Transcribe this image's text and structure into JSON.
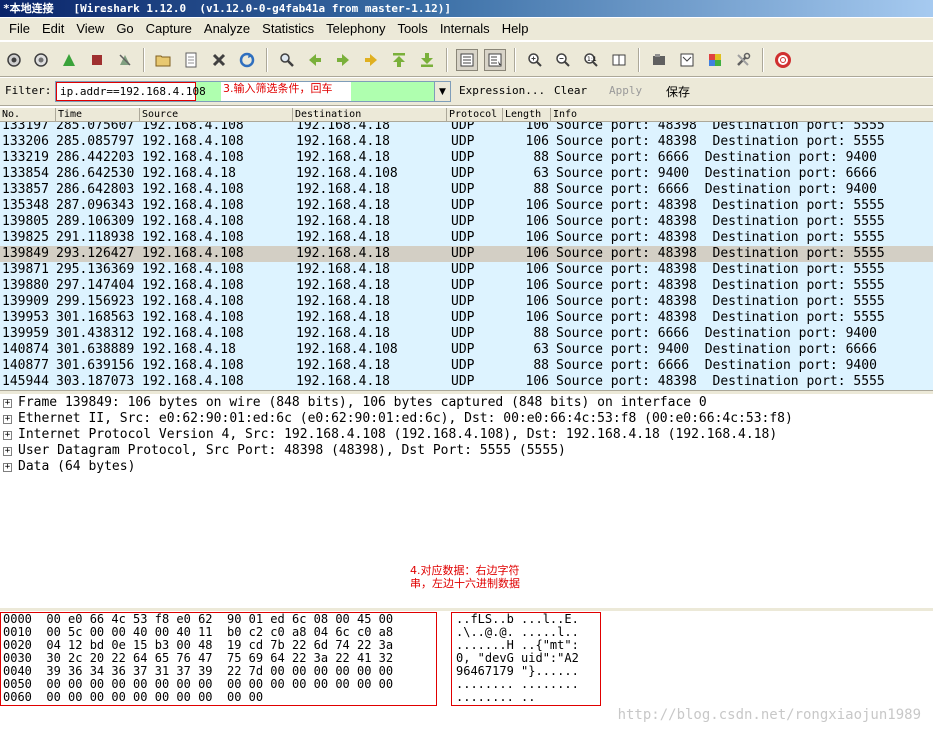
{
  "window": {
    "title": "*本地连接   [Wireshark 1.12.0  (v1.12.0-0-g4fab41a from master-1.12)]"
  },
  "menu": [
    "File",
    "Edit",
    "View",
    "Go",
    "Capture",
    "Analyze",
    "Statistics",
    "Telephony",
    "Tools",
    "Internals",
    "Help"
  ],
  "filter": {
    "label": "Filter:",
    "value": "ip.addr==192.168.4.108",
    "annotation": "3.输入筛选条件，回车",
    "expression_label": "Expression...",
    "clear_label": "Clear",
    "apply_label": "Apply",
    "save_label": "保存"
  },
  "packet_list": {
    "columns": [
      "No.",
      "Time",
      "Source",
      "Destination",
      "Protocol",
      "Length",
      "Info"
    ],
    "partial_row": {
      "no": "133197",
      "time": "285.075607",
      "source": "192.168.4.108",
      "destination": "192.168.4.18",
      "protocol": "UDP",
      "length": "106",
      "info": "Source port: 48398  Destination port: 5555"
    },
    "rows": [
      {
        "no": "133206",
        "time": "285.085797",
        "source": "192.168.4.108",
        "destination": "192.168.4.18",
        "protocol": "UDP",
        "length": "106",
        "info": "Source port: 48398  Destination port: 5555"
      },
      {
        "no": "133219",
        "time": "286.442203",
        "source": "192.168.4.108",
        "destination": "192.168.4.18",
        "protocol": "UDP",
        "length": "88",
        "info": "Source port: 6666  Destination port: 9400"
      },
      {
        "no": "133854",
        "time": "286.642530",
        "source": "192.168.4.18",
        "destination": "192.168.4.108",
        "protocol": "UDP",
        "length": "63",
        "info": "Source port: 9400  Destination port: 6666"
      },
      {
        "no": "133857",
        "time": "286.642803",
        "source": "192.168.4.108",
        "destination": "192.168.4.18",
        "protocol": "UDP",
        "length": "88",
        "info": "Source port: 6666  Destination port: 9400"
      },
      {
        "no": "135348",
        "time": "287.096343",
        "source": "192.168.4.108",
        "destination": "192.168.4.18",
        "protocol": "UDP",
        "length": "106",
        "info": "Source port: 48398  Destination port: 5555"
      },
      {
        "no": "139805",
        "time": "289.106309",
        "source": "192.168.4.108",
        "destination": "192.168.4.18",
        "protocol": "UDP",
        "length": "106",
        "info": "Source port: 48398  Destination port: 5555"
      },
      {
        "no": "139825",
        "time": "291.118938",
        "source": "192.168.4.108",
        "destination": "192.168.4.18",
        "protocol": "UDP",
        "length": "106",
        "info": "Source port: 48398  Destination port: 5555"
      },
      {
        "no": "139849",
        "time": "293.126427",
        "source": "192.168.4.108",
        "destination": "192.168.4.18",
        "protocol": "UDP",
        "length": "106",
        "info": "Source port: 48398  Destination port: 5555",
        "selected": true
      },
      {
        "no": "139871",
        "time": "295.136369",
        "source": "192.168.4.108",
        "destination": "192.168.4.18",
        "protocol": "UDP",
        "length": "106",
        "info": "Source port: 48398  Destination port: 5555"
      },
      {
        "no": "139880",
        "time": "297.147404",
        "source": "192.168.4.108",
        "destination": "192.168.4.18",
        "protocol": "UDP",
        "length": "106",
        "info": "Source port: 48398  Destination port: 5555"
      },
      {
        "no": "139909",
        "time": "299.156923",
        "source": "192.168.4.108",
        "destination": "192.168.4.18",
        "protocol": "UDP",
        "length": "106",
        "info": "Source port: 48398  Destination port: 5555"
      },
      {
        "no": "139953",
        "time": "301.168563",
        "source": "192.168.4.108",
        "destination": "192.168.4.18",
        "protocol": "UDP",
        "length": "106",
        "info": "Source port: 48398  Destination port: 5555"
      },
      {
        "no": "139959",
        "time": "301.438312",
        "source": "192.168.4.108",
        "destination": "192.168.4.18",
        "protocol": "UDP",
        "length": "88",
        "info": "Source port: 6666  Destination port: 9400"
      },
      {
        "no": "140874",
        "time": "301.638889",
        "source": "192.168.4.18",
        "destination": "192.168.4.108",
        "protocol": "UDP",
        "length": "63",
        "info": "Source port: 9400  Destination port: 6666"
      },
      {
        "no": "140877",
        "time": "301.639156",
        "source": "192.168.4.108",
        "destination": "192.168.4.18",
        "protocol": "UDP",
        "length": "88",
        "info": "Source port: 6666  Destination port: 9400"
      },
      {
        "no": "145944",
        "time": "303.187073",
        "source": "192.168.4.108",
        "destination": "192.168.4.18",
        "protocol": "UDP",
        "length": "106",
        "info": "Source port: 48398  Destination port: 5555"
      }
    ]
  },
  "details": [
    "Frame 139849: 106 bytes on wire (848 bits), 106 bytes captured (848 bits) on interface 0",
    "Ethernet II, Src: e0:62:90:01:ed:6c (e0:62:90:01:ed:6c), Dst: 00:e0:66:4c:53:f8 (00:e0:66:4c:53:f8)",
    "Internet Protocol Version 4, Src: 192.168.4.108 (192.168.4.108), Dst: 192.168.4.18 (192.168.4.18)",
    "User Datagram Protocol, Src Port: 48398 (48398), Dst Port: 5555 (5555)",
    "Data (64 bytes)"
  ],
  "annotation_data": "4.对应数据：右边字符串，左边十六进制数据",
  "bytes": {
    "hex": [
      "0000  00 e0 66 4c 53 f8 e0 62  90 01 ed 6c 08 00 45 00",
      "0010  00 5c 00 00 40 00 40 11  b0 c2 c0 a8 04 6c c0 a8",
      "0020  04 12 bd 0e 15 b3 00 48  19 cd 7b 22 6d 74 22 3a",
      "0030  30 2c 20 22 64 65 76 47  75 69 64 22 3a 22 41 32",
      "0040  39 36 34 36 37 31 37 39  22 7d 00 00 00 00 00 00",
      "0050  00 00 00 00 00 00 00 00  00 00 00 00 00 00 00 00",
      "0060  00 00 00 00 00 00 00 00  00 00"
    ],
    "ascii": [
      "..fLS..b ...l..E.",
      ".\\..@.@. .....l..",
      ".......H ..{\"mt\":",
      "0, \"devG uid\":\"A2",
      "96467179 \"}......",
      "........ ........",
      "........ .."
    ]
  },
  "watermark": "http://blog.csdn.net/rongxiaojun1989"
}
